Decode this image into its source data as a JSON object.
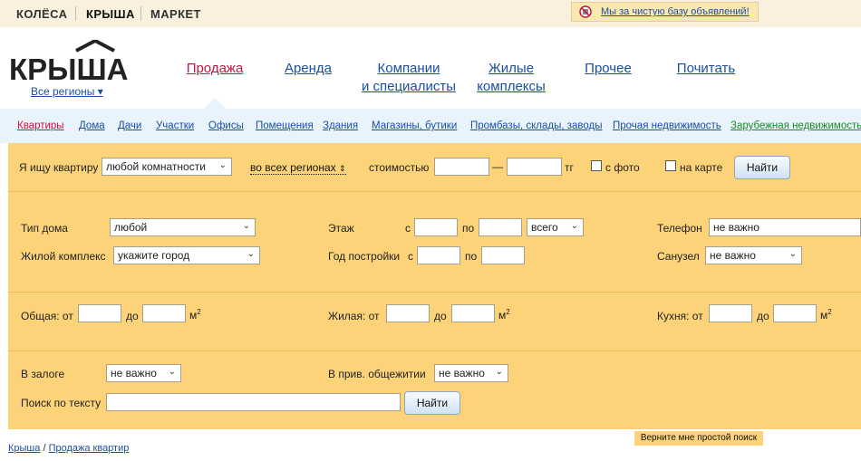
{
  "topbar": {
    "brands": [
      "КОЛЁСА",
      "КРЫША",
      "МАРКЕТ"
    ],
    "clean_link": "Мы за чистую базу объявлений!"
  },
  "header": {
    "logo_text": "КРЫША",
    "regions": "Все регионы ▾",
    "nav": [
      {
        "line1": "Продажа",
        "line2": ""
      },
      {
        "line1": "Аренда",
        "line2": ""
      },
      {
        "line1": "Компании",
        "line2": "и специалисты"
      },
      {
        "line1": "Жилые",
        "line2": "комплексы"
      },
      {
        "line1": "Прочее",
        "line2": ""
      },
      {
        "line1": "Почитать",
        "line2": ""
      }
    ]
  },
  "subnav": [
    "Квартиры",
    "Дома",
    "Дачи",
    "Участки",
    "Офисы",
    "Помещения",
    "Здания",
    "Магазины, бутики",
    "Промбазы, склады, заводы",
    "Прочая недвижимость",
    "Зарубежная недвижимость"
  ],
  "search_row": {
    "i_search": "Я ищу квартиру",
    "rooms_value": "любой комнатности",
    "regions_link": "во всех регионах",
    "price_label": "стоимостью",
    "dash": "—",
    "currency": "тг",
    "with_photo": "с фото",
    "on_map": "на карте",
    "find_button": "Найти"
  },
  "filters": {
    "house_type_label": "Тип дома",
    "house_type_value": "любой",
    "floor_label": "Этаж",
    "from": "с",
    "to_po": "по",
    "floor_total_value": "всего",
    "phone_label": "Телефон",
    "phone_value": "не важно",
    "complex_label": "Жилой комплекс",
    "complex_value": "укажите город",
    "year_label": "Год постройки",
    "bathroom_label": "Санузел",
    "bathroom_value": "не важно"
  },
  "areas": {
    "total_label": "Общая: от",
    "living_label": "Жилая: от",
    "kitchen_label": "Кухня: от",
    "to_do": "до",
    "unit": "м",
    "unit_sup": "2"
  },
  "extra": {
    "pledge_label": "В залоге",
    "pledge_value": "не важно",
    "dorm_label": "В прив. общежитии",
    "dorm_value": "не важно",
    "text_search_label": "Поиск по тексту",
    "find_button": "Найти"
  },
  "footer": {
    "crumb_home": "Крыша",
    "crumb_sep": "/",
    "crumb_current": "Продажа квартир",
    "simple_search": "Верните мне простой поиск"
  },
  "colors": {
    "form_bg": "#fcd379",
    "link": "#1a4fa3",
    "active": "#c4163f",
    "subnav_bg": "#e9f3fb"
  }
}
